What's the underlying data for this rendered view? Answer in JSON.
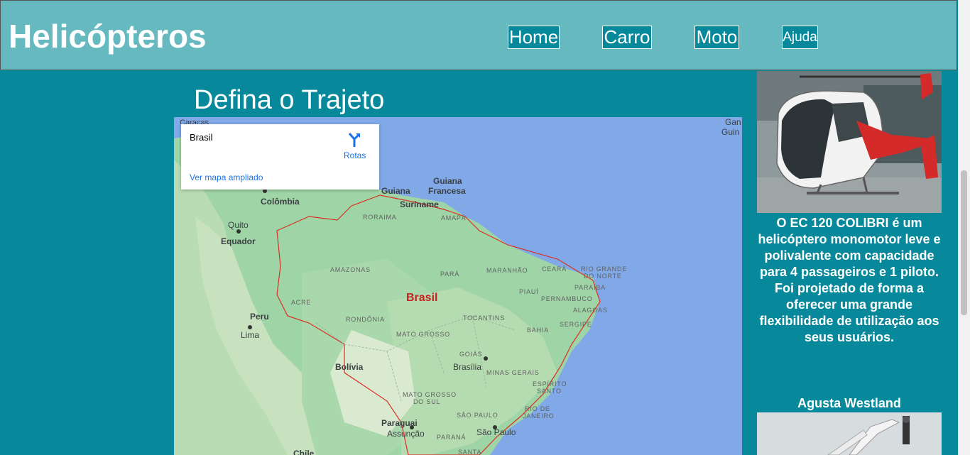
{
  "header": {
    "brand": "Helicópteros",
    "nav": [
      {
        "label": "Home"
      },
      {
        "label": "Carro"
      },
      {
        "label": "Moto"
      },
      {
        "label": "Ajuda"
      }
    ]
  },
  "main": {
    "title": "Defina o Trajeto"
  },
  "map": {
    "card": {
      "place": "Brasil",
      "directions_label": "Rotas",
      "larger_map_link": "Ver mapa ampliado"
    },
    "labels": {
      "guiana": "Guiana",
      "guiana_francesa_1": "Guiana",
      "guiana_francesa_2": "Francesa",
      "suriname": "Suriname",
      "colombia": "Colômbia",
      "quito": "Quito",
      "equador": "Equador",
      "peru": "Peru",
      "lima": "Lima",
      "bolivia": "Bolívia",
      "paraguai": "Paraguai",
      "assuncao": "Assunção",
      "chile": "Chile",
      "brasil": "Brasil",
      "brasilia": "Brasília",
      "sao_paulo": "São Paulo",
      "roraima": "RORAIMA",
      "amapa": "AMAPÁ",
      "amazonas": "AMAZONAS",
      "para": "PARÁ",
      "maranhao": "MARANHÃO",
      "ceara": "CEARÁ",
      "rio_grande_1": "RIO GRANDE",
      "rio_grande_2": "DO NORTE",
      "paraiba": "PARAÍBA",
      "piaui": "PIAUÍ",
      "pernambuco": "PERNAMBUCO",
      "alagoas": "ALAGOAS",
      "sergipe": "SERGIPE",
      "acre": "ACRE",
      "rondonia": "RONDÔNIA",
      "tocantins": "TOCANTINS",
      "bahia": "BAHIA",
      "mato_grosso": "MATO GROSSO",
      "goias": "GOIÁS",
      "minas_gerais": "MINAS GERAIS",
      "espirito_santo_1": "ESPÍRITO",
      "espirito_santo_2": "SANTO",
      "ms_1": "MATO GROSSO",
      "ms_2": "DO SUL",
      "rio_de_janeiro_1": "RIO DE",
      "rio_de_janeiro_2": "JANEIRO",
      "sao_paulo_state": "SÃO PAULO",
      "parana": "PARANÁ",
      "santa_catarina": "SANTA",
      "corner_1": "Gan",
      "corner_2": "Guin",
      "corner_left": "Caracas"
    }
  },
  "sidebar": {
    "description": "O EC 120 COLIBRI é um helicóptero monomotor leve e polivalente com capacidade para 4 passageiros e 1 piloto. Foi projetado de forma a oferecer uma grande flexibilidade de utilização aos seus usuários.",
    "second_title": "Agusta Westland"
  },
  "colors": {
    "page_bg": "#07889b",
    "header_bg": "#66b9bf",
    "text": "#ffffff",
    "map_water": "#81a9e8",
    "map_land": "#9fd4a6",
    "border_red": "#d93025"
  }
}
